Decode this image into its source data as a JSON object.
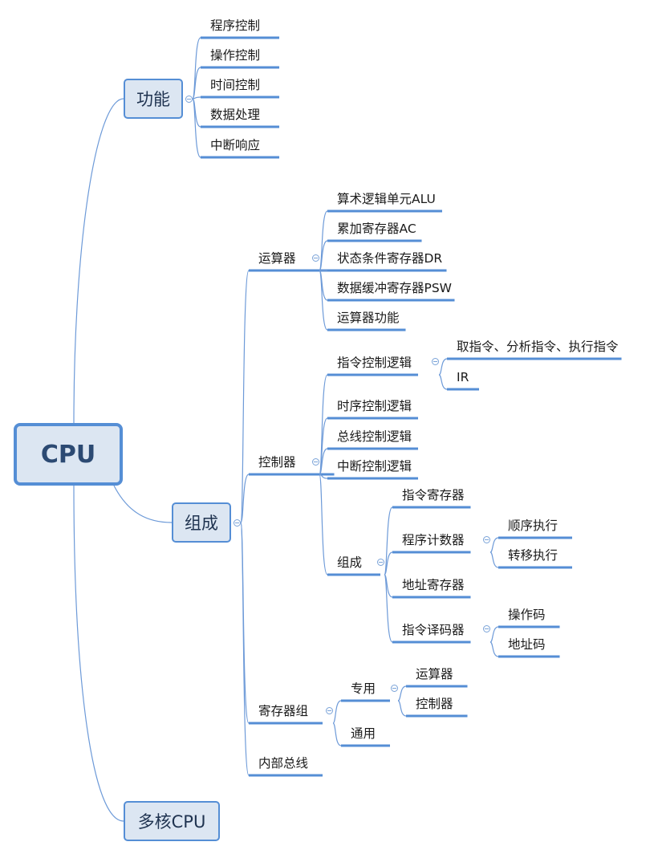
{
  "colors": {
    "accent": "#558ed5",
    "topic_fill": "#dce6f2",
    "line": "#6d9ad8",
    "underline": "#558ed5"
  },
  "mindmap": {
    "root": "CPU",
    "branches": [
      {
        "label": "功能",
        "children": [
          "程序控制",
          "操作控制",
          "时间控制",
          "数据处理",
          "中断响应"
        ]
      },
      {
        "label": "组成",
        "children": [
          {
            "label": "运算器",
            "children": [
              "算术逻辑单元ALU",
              "累加寄存器AC",
              "状态条件寄存器DR",
              "数据缓冲寄存器PSW",
              "运算器功能"
            ]
          },
          {
            "label": "控制器",
            "children": [
              {
                "label": "指令控制逻辑",
                "children": [
                  "取指令、分析指令、执行指令",
                  "IR"
                ]
              },
              "时序控制逻辑",
              "总线控制逻辑",
              "中断控制逻辑",
              {
                "label": "组成",
                "children": [
                  "指令寄存器",
                  {
                    "label": "程序计数器",
                    "children": [
                      "顺序执行",
                      "转移执行"
                    ]
                  },
                  "地址寄存器",
                  {
                    "label": "指令译码器",
                    "children": [
                      "操作码",
                      "地址码"
                    ]
                  }
                ]
              }
            ]
          },
          {
            "label": "寄存器组",
            "children": [
              {
                "label": "专用",
                "children": [
                  "运算器",
                  "控制器"
                ]
              },
              "通用"
            ]
          },
          "内部总线"
        ]
      },
      {
        "label": "多核CPU"
      }
    ]
  }
}
